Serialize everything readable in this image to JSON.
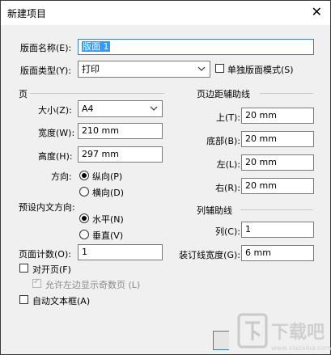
{
  "title": "新建项目",
  "close_glyph": "✕",
  "layout_name": {
    "label": "版面名称(E):",
    "value": "版面 1"
  },
  "layout_type": {
    "label": "版面类型(Y):",
    "value": "打印"
  },
  "single_layout_mode": {
    "label": "单独版面模式(S)",
    "checked": false
  },
  "page": {
    "heading": "页",
    "size_label": "大小(Z):",
    "size_value": "A4",
    "width_label": "宽度(W):",
    "width_value": "210 mm",
    "height_label": "高度(H):",
    "height_value": "297 mm",
    "orientation_label": "方向:",
    "portrait_label": "纵向(P)",
    "landscape_label": "横向(D)",
    "orientation_value": "纵向"
  },
  "margins": {
    "heading": "页边距辅助线",
    "top_label": "上(T):",
    "top_value": "20 mm",
    "bottom_label": "底部(B):",
    "bottom_value": "20 mm",
    "left_label": "左(L):",
    "left_value": "20 mm",
    "right_label": "右(R):",
    "right_value": "20 mm"
  },
  "text_direction": {
    "label": "预设内文方向:",
    "horizontal_label": "水平(N)",
    "vertical_label": "垂直(V)",
    "value": "水平"
  },
  "columns": {
    "heading": "列辅助线",
    "columns_label": "列(C):",
    "columns_value": "1",
    "gutter_label": "装订线宽度(G):",
    "gutter_value": "6 mm"
  },
  "page_count": {
    "label": "页面计数(O):",
    "value": "1"
  },
  "facing_pages": {
    "label": "对开页(F)",
    "checked": false
  },
  "allow_left_odd": {
    "label": "允许左边显示奇数页 (L)",
    "checked": true,
    "disabled": true
  },
  "auto_text_frame": {
    "label": "自动文本框(A)",
    "checked": false
  },
  "watermark": {
    "main": "下载吧",
    "sub": "www.xiazaiba.com"
  }
}
